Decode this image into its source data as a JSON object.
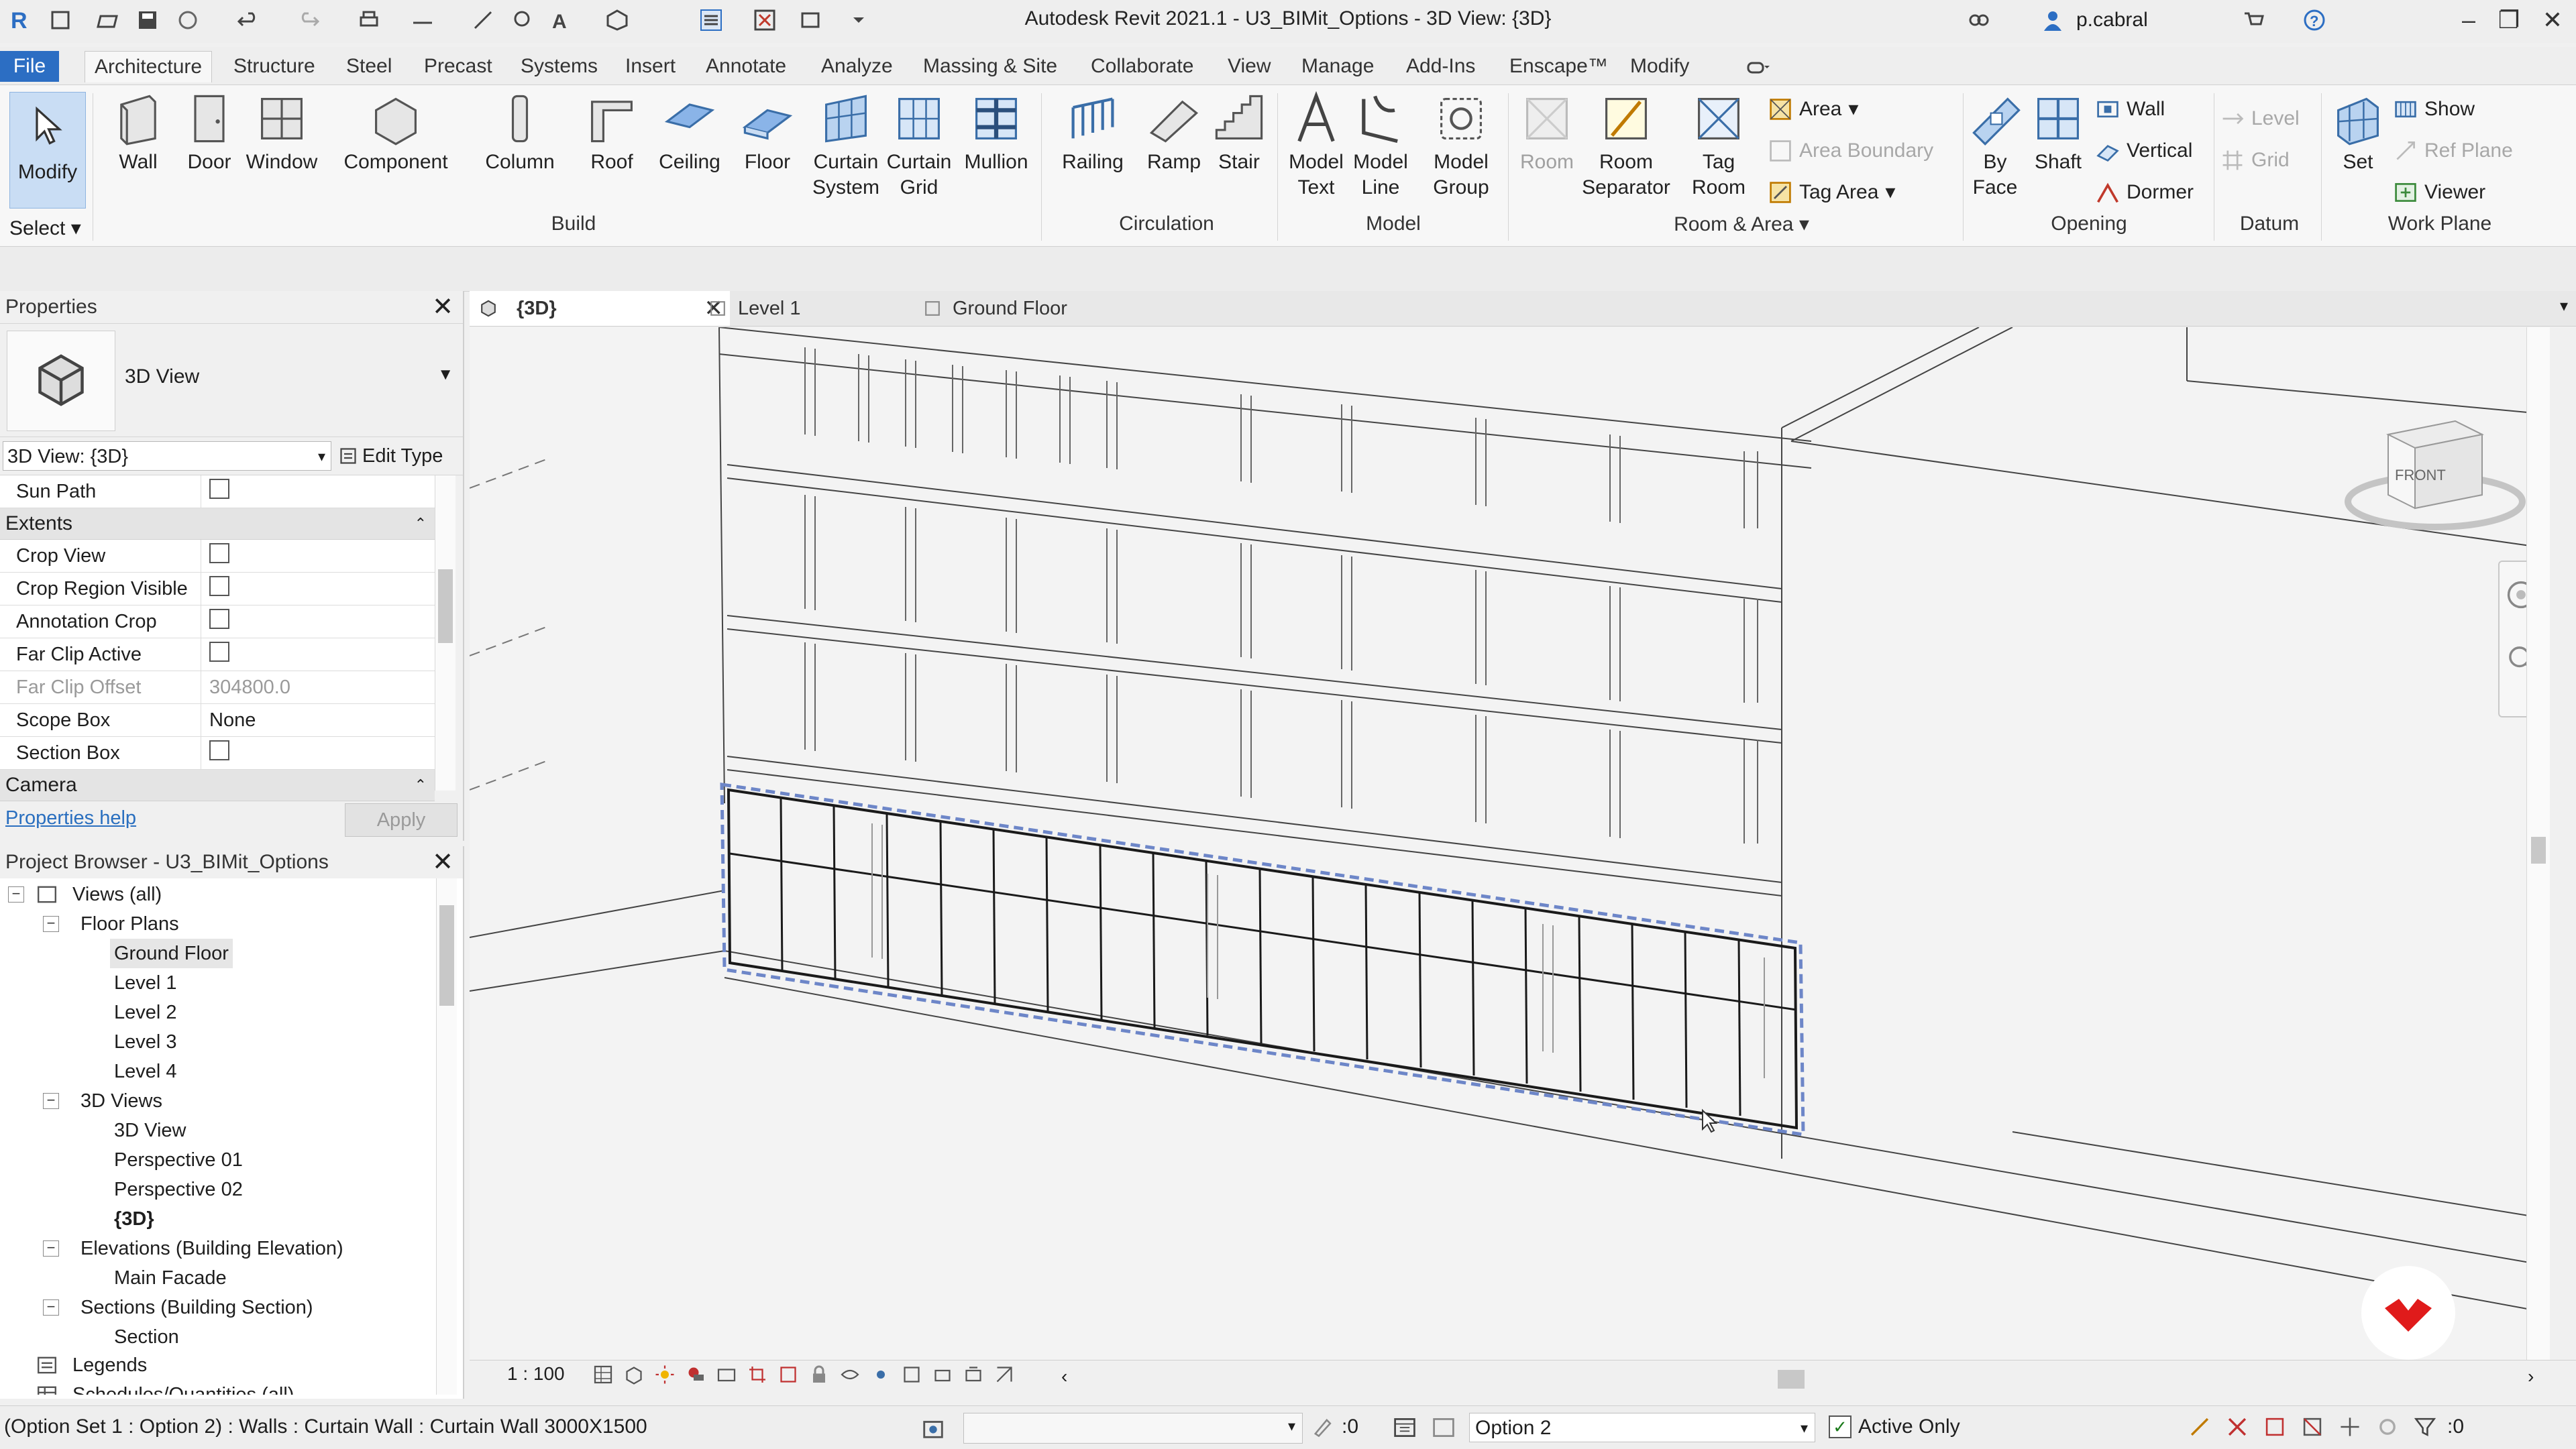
{
  "window": {
    "title": "Autodesk Revit 2021.1 - U3_BIMit_Options - 3D View: {3D}",
    "user": "p.cabral"
  },
  "ribbon_tabs": [
    "File",
    "Architecture",
    "Structure",
    "Steel",
    "Precast",
    "Systems",
    "Insert",
    "Annotate",
    "Analyze",
    "Massing & Site",
    "Collaborate",
    "View",
    "Manage",
    "Add-Ins",
    "Enscape™",
    "Modify"
  ],
  "ribbon": {
    "select_label": "Select",
    "modify": "Modify",
    "build": {
      "label": "Build",
      "items": [
        "Wall",
        "Door",
        "Window",
        "Component",
        "Column",
        "Roof",
        "Ceiling",
        "Floor",
        "Curtain System",
        "Curtain Grid",
        "Mullion"
      ]
    },
    "circulation": {
      "label": "Circulation",
      "items": [
        "Railing",
        "Ramp",
        "Stair"
      ]
    },
    "model": {
      "label": "Model",
      "items": [
        "Model Text",
        "Model Line",
        "Model Group"
      ]
    },
    "room_area": {
      "label": "Room & Area",
      "room": "Room",
      "room_separator": "Room Separator",
      "tag_room": "Tag Room",
      "area": "Area",
      "area_boundary": "Area  Boundary",
      "tag_area": "Tag  Area"
    },
    "opening": {
      "label": "Opening",
      "by_face": "By Face",
      "shaft": "Shaft",
      "wall": "Wall",
      "vertical": "Vertical",
      "dormer": "Dormer"
    },
    "datum": {
      "label": "Datum",
      "level": "Level",
      "grid": "Grid"
    },
    "work_plane": {
      "label": "Work Plane",
      "set": "Set",
      "show": "Show",
      "ref_plane": "Ref  Plane",
      "viewer": "Viewer"
    }
  },
  "properties": {
    "title": "Properties",
    "type_name": "3D View",
    "instance_selector": "3D View: {3D}",
    "edit_type": "Edit Type",
    "rows_top": [
      {
        "name": "Sun Path",
        "value": ""
      }
    ],
    "extents_label": "Extents",
    "extents_rows": [
      {
        "name": "Crop View",
        "value": ""
      },
      {
        "name": "Crop Region Visible",
        "value": ""
      },
      {
        "name": "Annotation Crop",
        "value": ""
      },
      {
        "name": "Far Clip Active",
        "value": ""
      },
      {
        "name": "Far Clip Offset",
        "value": "304800.0"
      },
      {
        "name": "Scope Box",
        "value": "None"
      },
      {
        "name": "Section Box",
        "value": ""
      }
    ],
    "camera_label": "Camera",
    "help_link": "Properties help",
    "apply": "Apply"
  },
  "project_browser": {
    "title": "Project Browser - U3_BIMit_Options",
    "items": [
      "Views (all)",
      "Floor Plans",
      "Ground Floor",
      "Level 1",
      "Level 2",
      "Level 3",
      "Level 4",
      "3D Views",
      "3D View",
      "Perspective 01",
      "Perspective 02",
      "{3D}",
      "Elevations (Building Elevation)",
      "Main Facade",
      "Sections (Building Section)",
      "Section",
      "Legends",
      "Schedules/Quantities (all)"
    ]
  },
  "view_tabs": [
    "{3D}",
    "Level 1",
    "Ground Floor"
  ],
  "viewcube_label": "FRONT",
  "view_bar": {
    "scale": "1 : 100"
  },
  "status": {
    "message": "(Option Set 1 : Option 2) : Walls : Curtain Wall : Curtain Wall 3000X1500",
    "zero": ":0",
    "option": "Option 2",
    "active_only": "Active Only",
    "filter_count": ":0"
  }
}
